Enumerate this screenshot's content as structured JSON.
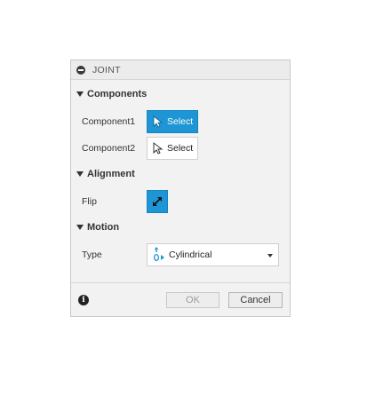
{
  "dialog": {
    "title": "JOINT",
    "sections": {
      "components": {
        "header": "Components",
        "rows": [
          {
            "label": "Component1",
            "button": "Select",
            "state": "active"
          },
          {
            "label": "Component2",
            "button": "Select",
            "state": "inactive"
          }
        ]
      },
      "alignment": {
        "header": "Alignment",
        "flip_label": "Flip"
      },
      "motion": {
        "header": "Motion",
        "type_label": "Type",
        "type_value": "Cylindrical"
      }
    },
    "footer": {
      "info_glyph": "i",
      "ok_label": "OK",
      "ok_enabled": false,
      "cancel_label": "Cancel"
    }
  },
  "colors": {
    "accent": "#1e96d5",
    "panel_bg": "#f2f2f2",
    "border": "#c9c9c9"
  },
  "icons": [
    "minus-circle-icon",
    "cursor-arrow-icon",
    "flip-arrows-icon",
    "cylindrical-joint-icon",
    "chevron-down-icon",
    "info-icon"
  ]
}
